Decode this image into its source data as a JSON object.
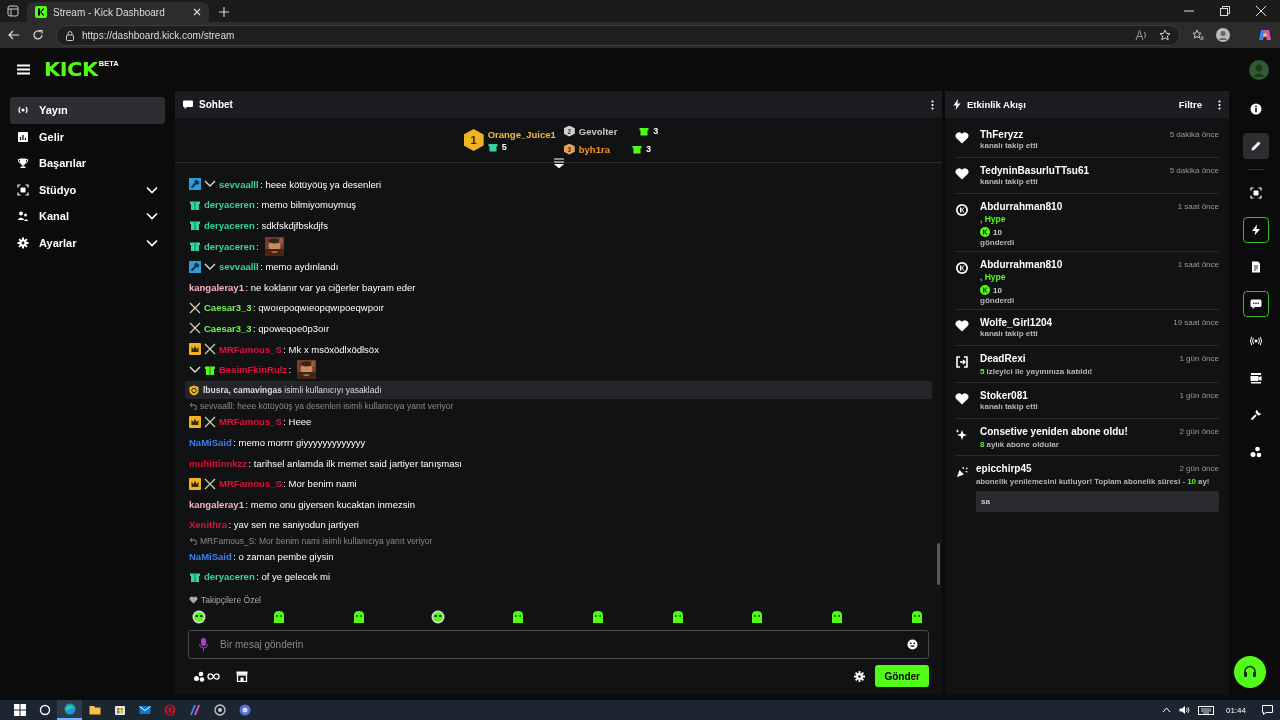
{
  "browser": {
    "tab_title": "Stream - Kick Dashboard",
    "url": "https://dashboard.kick.com/stream"
  },
  "header": {
    "logo": "KICK",
    "logo_badge": "BETA"
  },
  "sidebar": {
    "items": [
      {
        "label": "Yayın",
        "kind": "stream",
        "selected": true,
        "expandable": false
      },
      {
        "label": "Gelir",
        "kind": "revenue",
        "selected": false,
        "expandable": false
      },
      {
        "label": "Başarılar",
        "kind": "trophy",
        "selected": false,
        "expandable": false
      },
      {
        "label": "Stüdyo",
        "kind": "studio",
        "selected": false,
        "expandable": true
      },
      {
        "label": "Kanal",
        "kind": "channel",
        "selected": false,
        "expandable": true
      },
      {
        "label": "Ayarlar",
        "kind": "settings",
        "selected": false,
        "expandable": true
      }
    ]
  },
  "chat": {
    "title": "Sohbet",
    "leaderboard": [
      {
        "rank": "1",
        "name": "Orange_Juice1",
        "count": "5",
        "color": "#f5b942"
      },
      {
        "rank": "2",
        "name": "Gevolter",
        "count": "3",
        "color": "#c8c8c8"
      },
      {
        "rank": "3",
        "name": "byh1ra",
        "count": "3",
        "color": "#f0932b"
      }
    ],
    "messages": [
      {
        "kind": "message",
        "badges": [
          {
            "kind": "moderator"
          },
          {
            "kind": "vip"
          }
        ],
        "name": "sevvaalll",
        "color": "#35d49b",
        "text": ": heee kötüyöüş ya desenleri"
      },
      {
        "kind": "message",
        "badges": [
          {
            "kind": "sub"
          }
        ],
        "name": "deryaceren",
        "color": "#35d49b",
        "text": ": memo bilmiyomuymuş"
      },
      {
        "kind": "message",
        "badges": [
          {
            "kind": "sub"
          }
        ],
        "name": "deryaceren",
        "color": "#35d49b",
        "text": ": sdkfskdjfbskdjfs"
      },
      {
        "kind": "message",
        "badges": [
          {
            "kind": "sub"
          }
        ],
        "name": "deryaceren",
        "color": "#35d49b",
        "text": ":",
        "emote": true
      },
      {
        "kind": "message",
        "badges": [
          {
            "kind": "moderator"
          },
          {
            "kind": "vip"
          }
        ],
        "name": "sevvaalll",
        "color": "#35d49b",
        "text": ": memo aydınlandı"
      },
      {
        "kind": "message",
        "name": "kangaleray1",
        "color": "#f7b3c6",
        "text": ": ne koklanır var ya ciğerler bayram eder"
      },
      {
        "kind": "message",
        "badges": [
          {
            "kind": "sword"
          }
        ],
        "name": "Caesar3_3",
        "color": "#74f44e",
        "text": ": qwoıepoqwıeopqwıpoeqwpoır"
      },
      {
        "kind": "message",
        "badges": [
          {
            "kind": "sword"
          }
        ],
        "name": "Caesar3_3",
        "color": "#74f44e",
        "text": ": qpoweqoe0p3oır"
      },
      {
        "kind": "message",
        "badges": [
          {
            "kind": "crown"
          },
          {
            "kind": "sword"
          }
        ],
        "name": "MRFamous_S",
        "color": "#e0103c",
        "text": ": Mk x msöxödlxödlsöx"
      },
      {
        "kind": "message",
        "badges": [
          {
            "kind": "vip"
          },
          {
            "kind": "gifter"
          }
        ],
        "name": "BesimFkinRulz",
        "color": "#e0103c",
        "text": ":",
        "emote": true
      },
      {
        "kind": "notice",
        "text": "**lbusra, camavingas** isimli kullanıcıyı yasakladı"
      },
      {
        "kind": "message",
        "badges": [
          {
            "kind": "crown"
          },
          {
            "kind": "sword"
          }
        ],
        "name": "MRFamous_S",
        "color": "#e0103c",
        "text": ": Heee",
        "reply": "sevvaalll: heee kötüyöüş ya desenleri isimli kullanıcıya yanıt veriyor"
      },
      {
        "kind": "message",
        "name": "NaMiSaid",
        "color": "#3b7ff0",
        "text": ": memo morrrr giyyyyyyyyyyyyy"
      },
      {
        "kind": "message",
        "name": "muhittinnkzz",
        "color": "#d4103a",
        "text": ": tarihsel anlamda ilk memet said jartiyer tanışması"
      },
      {
        "kind": "message",
        "badges": [
          {
            "kind": "crown"
          },
          {
            "kind": "sword"
          }
        ],
        "name": "MRFamous_S",
        "color": "#e0103c",
        "text": ": Mor benim nami"
      },
      {
        "kind": "message",
        "name": "kangaleray1",
        "color": "#f7b3c6",
        "text": ": memo onu giyersen kucaktan inmezsin"
      },
      {
        "kind": "message",
        "name": "Xenithra",
        "color": "#e0103c",
        "text": ": yav sen ne saniyodun jartiyeri"
      },
      {
        "kind": "message",
        "name": "NaMiSaid",
        "color": "#3b7ff0",
        "text": ": o zaman pembe giysin",
        "reply": "MRFamous_S: Mor benim nami isimli kullanıcıya yanıt veriyor"
      },
      {
        "kind": "message",
        "badges": [
          {
            "kind": "sub"
          }
        ],
        "name": "deryaceren",
        "color": "#35d49b",
        "text": ": of ye gelecek mi"
      }
    ],
    "followers_only": "Takipçilere Özel",
    "input": {
      "placeholder": "Bir mesaj gönderin"
    },
    "send_button": "Gönder"
  },
  "activity": {
    "title": "Etkinlik Akışı",
    "filter": "Filtre",
    "items": [
      {
        "kind": "follow",
        "name": "ThFeryzz",
        "time": "5 dakika önce",
        "text": "kanalı takip etti"
      },
      {
        "kind": "follow",
        "name": "TedyninBasurluTTsu61",
        "time": "5 dakika önce",
        "text": "kanalı takip etti"
      },
      {
        "kind": "gift",
        "name": "Abdurrahman810",
        "time": "1 saat önce",
        "item": ", Hype",
        "amount": "10",
        "text": "gönderdi"
      },
      {
        "kind": "gift",
        "name": "Abdurrahman810",
        "time": "1 saat önce",
        "item": ", Hype",
        "amount": "10",
        "text": "gönderdi"
      },
      {
        "kind": "follow",
        "name": "Wolfe_Girl1204",
        "time": "19 saat önce",
        "text": "kanalı takip etti"
      },
      {
        "kind": "host",
        "name": "DeadRexi",
        "time": "1 gün önce",
        "count": "5",
        "text": "izleyici ile yayınınıza katıldı!"
      },
      {
        "kind": "follow",
        "name": "Stoker081",
        "time": "1 gün önce",
        "text": "kanalı takip etti"
      },
      {
        "kind": "resub",
        "name": "Consetive yeniden abone oldu!",
        "time": "2 gün önce",
        "count": "8",
        "text": "aylık abone oldular"
      },
      {
        "kind": "renew",
        "name": "epicchirp45",
        "time": "2 gün önce",
        "text": "abonelik yenilemesini kutluyor! Toplam abonelik süresi -",
        "count": "10",
        "suffix": "ay!",
        "message": "sa"
      }
    ]
  },
  "rail": [
    {
      "kind": "info",
      "selected": false,
      "active": false
    },
    {
      "kind": "edit",
      "selected": true,
      "active": false
    },
    {
      "kind": "studio",
      "selected": false,
      "active": false
    },
    {
      "kind": "events",
      "selected": false,
      "active": true
    },
    {
      "kind": "notes",
      "selected": false,
      "active": false
    },
    {
      "kind": "chat",
      "selected": false,
      "active": true
    },
    {
      "kind": "broadcast",
      "selected": false,
      "active": false
    },
    {
      "kind": "camera",
      "selected": false,
      "active": false
    },
    {
      "kind": "tools",
      "selected": false,
      "active": false
    },
    {
      "kind": "connections",
      "selected": false,
      "active": false
    }
  ],
  "taskbar": {
    "time": "01:44"
  }
}
